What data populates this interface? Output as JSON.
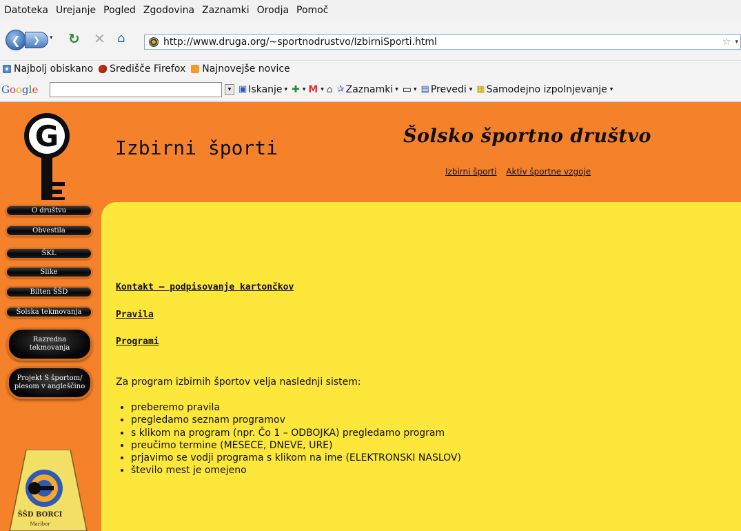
{
  "menu": [
    "Datoteka",
    "Urejanje",
    "Pogled",
    "Zgodovina",
    "Zaznamki",
    "Orodja",
    "Pomoč"
  ],
  "nav": {
    "url": "http://www.druga.org/~sportnodrustvo/IzbirniSporti.html"
  },
  "bookmarks": [
    "Najbolj obiskano",
    "Središče Firefox",
    "Najnovejše novice"
  ],
  "google_toolbar": {
    "logo": "Google",
    "items": [
      "Iskanje",
      "Zaznamki",
      "Prevedi",
      "Samodejno izpolnjevanje"
    ]
  },
  "site": {
    "title": "Šolsko športno društvo",
    "top_links": [
      "Izbirni športi",
      "Aktiv športne vzgoje"
    ],
    "sidebar": [
      "O društvu",
      "Obvestila",
      "ŠKL",
      "Slike",
      "Bilten ŠŠD",
      "Šolska tekmovanja"
    ],
    "sidebar_big": [
      [
        "Razredna",
        "tekmovanja"
      ],
      [
        "Projekt S športom/",
        "plesom v angleščino"
      ]
    ],
    "club_logo_text": [
      "ŠŠD BORCI",
      "Maribor"
    ]
  },
  "main": {
    "heading": "Izbirni športi",
    "links": [
      "Kontakt – podpisovanje kartončkov",
      "Pravila",
      "Programi"
    ],
    "intro": "Za program izbirnih športov velja naslednji sistem:",
    "rules": [
      "preberemo pravila",
      "pregledamo seznam programov",
      "s klikom na program (npr. Čo 1 – ODBOJKA) pregledamo program",
      "preučimo termine (MESECE, DNEVE, URE)",
      "prjavimo se vodji programa s klikom na ime (ELEKTRONSKI NASLOV)",
      "število mest je omejeno"
    ]
  },
  "colors": {
    "header_orange": "#f5812b",
    "content_yellow": "#fce73a"
  }
}
